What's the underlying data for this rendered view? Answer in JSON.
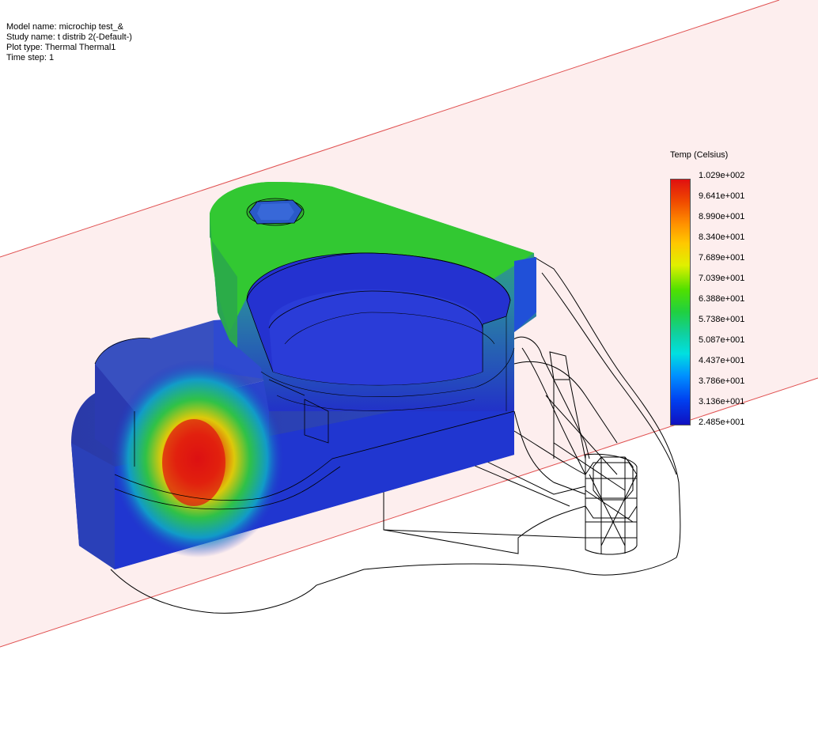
{
  "info": {
    "model_name": "Model name: microchip test_&",
    "study_name": "Study name: t distrib 2(-Default-)",
    "plot_type": "Plot type: Thermal Thermal1",
    "time_step": "Time step: 1"
  },
  "legend": {
    "title": "Temp (Celsius)",
    "ticks": [
      "1.029e+002",
      "9.641e+001",
      "8.990e+001",
      "8.340e+001",
      "7.689e+001",
      "7.039e+001",
      "6.388e+001",
      "5.738e+001",
      "5.087e+001",
      "4.437e+001",
      "3.786e+001",
      "3.136e+001",
      "2.485e+001"
    ],
    "colors": [
      "#e01010",
      "#ff9000",
      "#e0f000",
      "#20d040",
      "#00e0e0",
      "#0090ff",
      "#1010c0"
    ]
  },
  "colors": {
    "section_plane_fill": "#fdeeee",
    "section_plane_edge": "#e05050",
    "wireframe": "#000000",
    "part_cool": "#1e28c8",
    "part_top": "#32c832",
    "hotspot": "#e01010"
  }
}
